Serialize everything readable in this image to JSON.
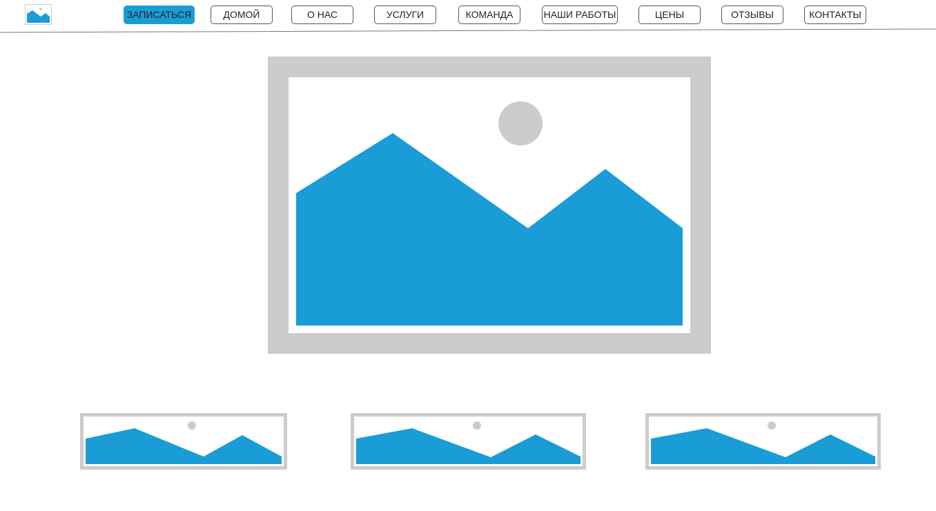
{
  "header": {
    "logo_icon": "image-placeholder-icon",
    "nav": [
      {
        "label": "ЗАПИСАТЬСЯ",
        "active": true
      },
      {
        "label": "ДОМОЙ"
      },
      {
        "label": "О НАС"
      },
      {
        "label": "УСЛУГИ"
      },
      {
        "label": "КОМАНДА"
      },
      {
        "label": "НАШИ РАБОТЫ"
      },
      {
        "label": "ЦЕНЫ"
      },
      {
        "label": "ОТЗЫВЫ"
      },
      {
        "label": "КОНТАКТЫ"
      }
    ]
  },
  "main": {
    "hero_image_icon": "image-placeholder-icon",
    "thumbnails": [
      {
        "icon": "image-placeholder-icon"
      },
      {
        "icon": "image-placeholder-icon"
      },
      {
        "icon": "image-placeholder-icon"
      }
    ]
  },
  "colors": {
    "accent": "#1a9cd6",
    "placeholder_frame": "#cccccc",
    "button_border": "#555555"
  }
}
